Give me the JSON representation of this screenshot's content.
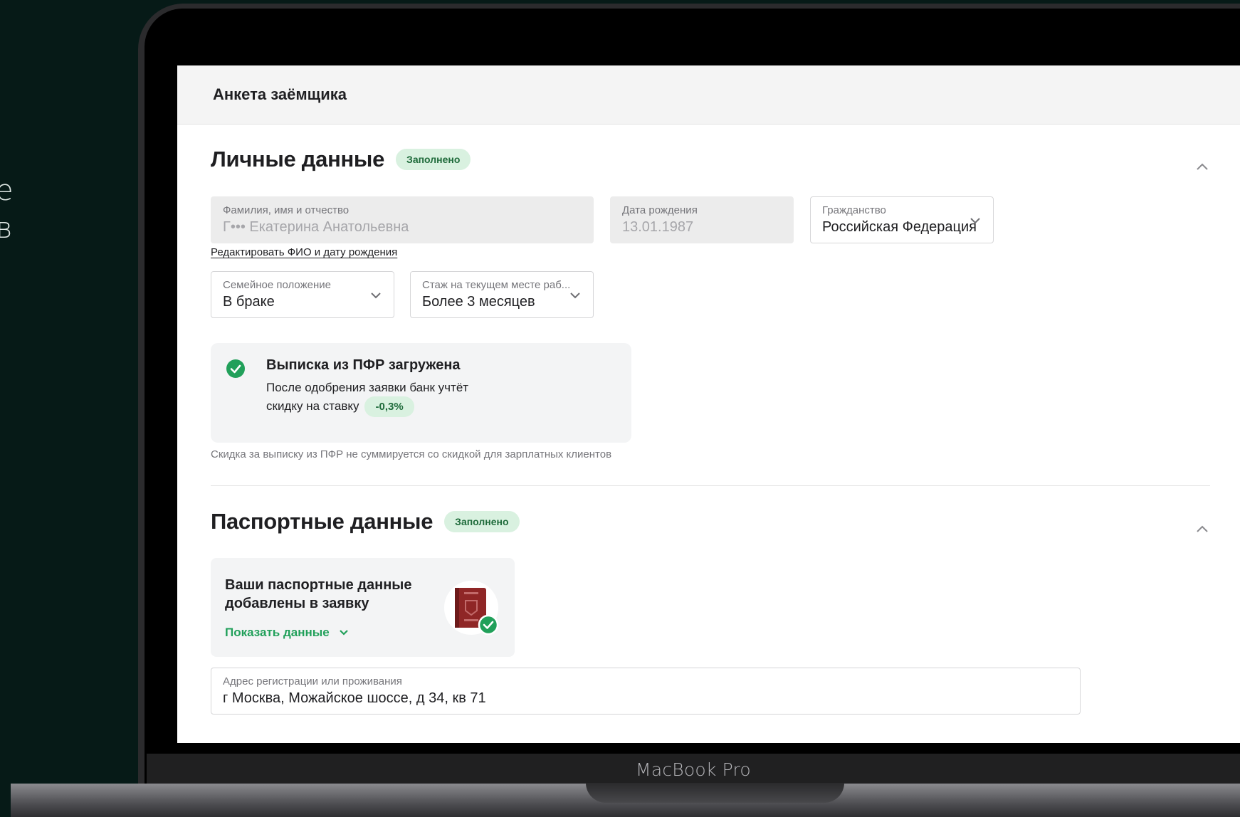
{
  "background": {
    "fragments": [
      "e",
      "в"
    ]
  },
  "device": {
    "label": "MacBook Pro"
  },
  "header": {
    "title": "Анкета заёмщика"
  },
  "personal": {
    "title": "Личные данные",
    "status": "Заполнено",
    "full_name": {
      "label": "Фамилия, имя и отчество",
      "value": "Г••• Екатерина Анатольевна"
    },
    "birth_date": {
      "label": "Дата рождения",
      "value": "13.01.1987"
    },
    "citizenship": {
      "label": "Гражданство",
      "value": "Российская Федерация"
    },
    "edit_link": "Редактировать ФИО и дату рождения",
    "marital": {
      "label": "Семейное положение",
      "value": "В браке"
    },
    "experience": {
      "label": "Стаж на текущем месте раб...",
      "value": "Более 3 месяцев"
    },
    "pfr": {
      "title": "Выписка из ПФР загружена",
      "text": "После одобрения заявки банк учтёт скидку на ставку",
      "discount": "-0,3%",
      "note": "Скидка за выписку из ПФР не суммируется со скидкой для зарплатных клиентов"
    }
  },
  "passport": {
    "title": "Паспортные данные",
    "status": "Заполнено",
    "card_title": "Ваши паспортные данные добавлены в заявку",
    "show_link": "Показать данные",
    "address": {
      "label": "Адрес регистрации или проживания",
      "value": "г Москва, Можайское шоссе, д 34, кв 71"
    }
  },
  "colors": {
    "accent": "#21a05a",
    "badge_bg": "#d9f1e0",
    "badge_text": "#1f6b3b",
    "card_bg": "#f3f4f5",
    "page_bg": "#061a17"
  },
  "icons": {
    "collapse": "chevron-up-icon",
    "dropdown": "chevron-down-icon",
    "success": "check-circle-icon",
    "passport": "passport-book-icon"
  }
}
